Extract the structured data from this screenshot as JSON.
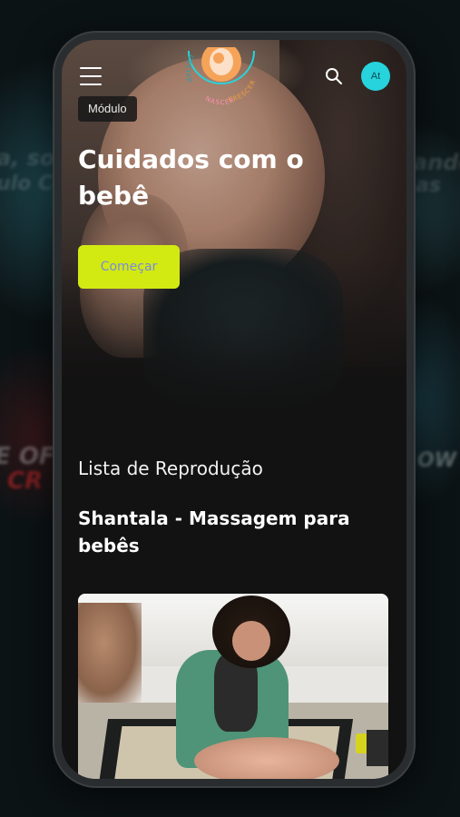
{
  "header": {
    "logo_text": [
      "GESTAR",
      "NASCER",
      "CRESCER"
    ],
    "avatar_initials": "At",
    "icons": {
      "menu": "hamburger-menu-icon",
      "search": "search-icon"
    }
  },
  "hero": {
    "badge": "Módulo",
    "title": "Cuidados com o bebê",
    "start_button": "Começar"
  },
  "playlist": {
    "heading": "Lista de Reprodução",
    "course_title": "Shantala - Massagem para bebês"
  },
  "colors": {
    "accent_button": "#d2ea11",
    "avatar_bg": "#27d3dc",
    "background": "#121212"
  },
  "background_texts": [
    "a, son",
    "ulo Co",
    "ando",
    "as",
    "E OF",
    "CR",
    "OW"
  ]
}
